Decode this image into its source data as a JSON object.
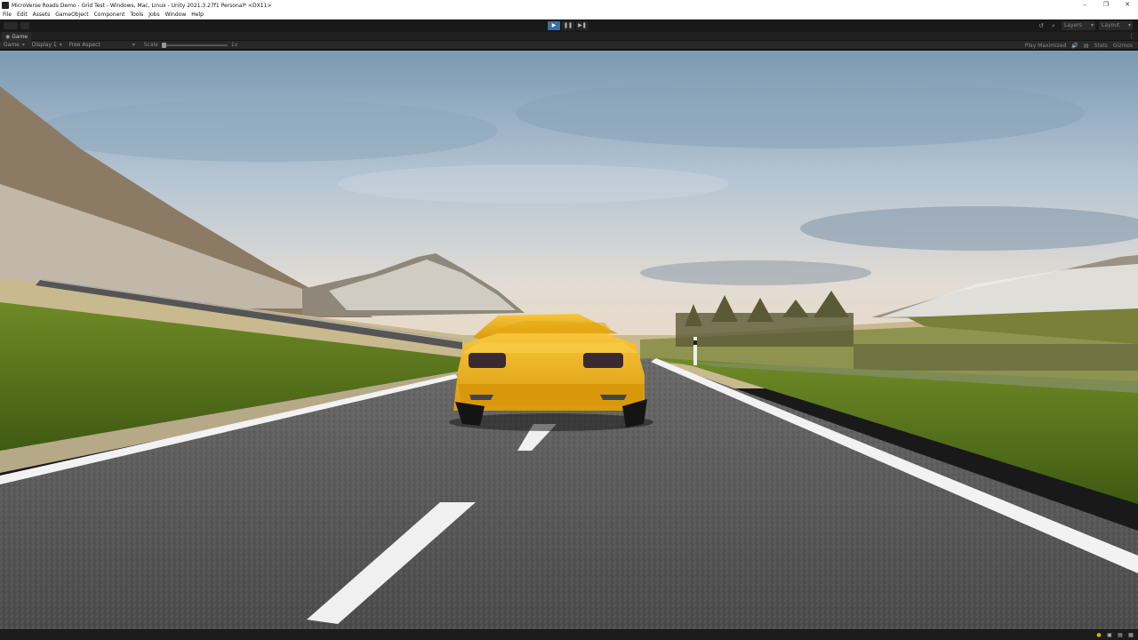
{
  "window": {
    "title": "MicroVerse Roads Demo - Grid Test - Windows, Mac, Linux - Unity 2021.3.27f1 Personal* <DX11>",
    "controls": [
      "–",
      "❐",
      "✕"
    ]
  },
  "menu": [
    "File",
    "Edit",
    "Assets",
    "GameObject",
    "Component",
    "Tools",
    "Jobs",
    "Window",
    "Help"
  ],
  "toolbar": {
    "play_icon": "▶",
    "pause_icon": "❚❚",
    "step_icon": "▶❚",
    "history_icon": "↺",
    "search_icon": "⌕",
    "layers_label": "Layers",
    "layout_label": "Layout"
  },
  "tab": {
    "label": "Game",
    "icon": "game-controller-icon",
    "menu_icon": "⋮"
  },
  "gamebar": {
    "view": "Game",
    "display": "Display 1",
    "aspect": "Free Aspect",
    "scale_label": "Scale",
    "scale_value": "1x",
    "scale_fraction": 0.0,
    "play_mode": "Play Maximized",
    "mute_icon": "🔊",
    "stats_icon": "▤",
    "stats_label": "Stats",
    "gizmos_label": "Gizmos"
  },
  "status_icons": [
    "●",
    "▣",
    "▤",
    "▦"
  ],
  "colors": {
    "play_active": "#3a6ea5",
    "car_body": "#f0b520",
    "sky_top": "#7b99b3",
    "grass": "#5e7a1e",
    "asphalt": "#575757"
  }
}
